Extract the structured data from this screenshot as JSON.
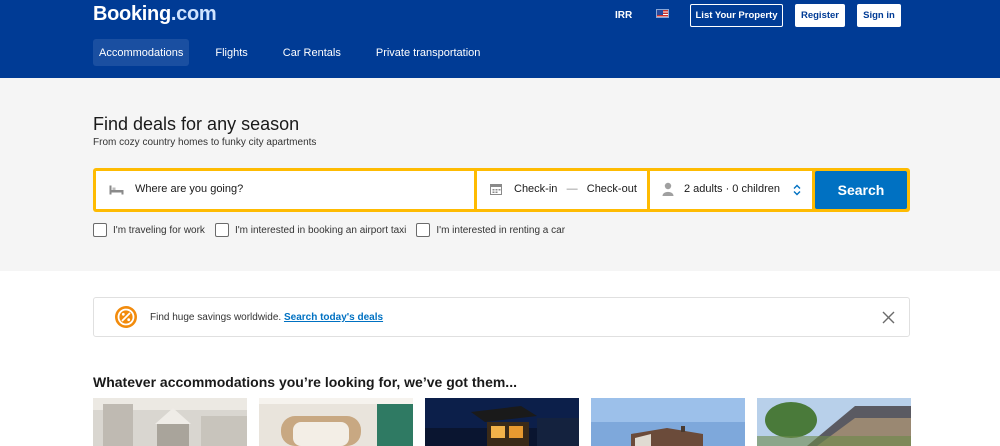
{
  "header": {
    "logo_main": "Booking",
    "logo_suffix": ".com",
    "currency": "IRR",
    "list_property_label": "List Your Property",
    "register_label": "Register",
    "signin_label": "Sign in"
  },
  "nav": {
    "items": [
      {
        "label": "Accommodations",
        "active": true
      },
      {
        "label": "Flights",
        "active": false
      },
      {
        "label": "Car Rentals",
        "active": false
      },
      {
        "label": "Private transportation",
        "active": false
      }
    ]
  },
  "hero": {
    "title": "Find deals for any season",
    "subtitle": "From cozy country homes to funky city apartments"
  },
  "search": {
    "destination_placeholder": "Where are you going?",
    "checkin": "Check-in",
    "separator": "—",
    "checkout": "Check-out",
    "guests": "2 adults · 0 children",
    "button_label": "Search"
  },
  "options": [
    {
      "label": "I'm traveling for work",
      "checked": false
    },
    {
      "label": "I'm interested in booking an airport taxi",
      "checked": false
    },
    {
      "label": "I'm interested in renting a car",
      "checked": false
    }
  ],
  "banner": {
    "text": "Find huge savings worldwide.",
    "link": "Search today's deals"
  },
  "section": {
    "title": "Whatever accommodations you’re looking for, we’ve got them..."
  },
  "colors": {
    "brand_blue": "#003b95",
    "search_yellow": "#febb02",
    "search_button": "#0071c2",
    "banner_icon_orange": "#f28b0c"
  },
  "icons": {
    "destination": "bed-icon",
    "dates": "calendar-icon",
    "guests": "person-icon",
    "guests_toggle": "chevron-up-down-icon",
    "banner": "deal-tag-icon",
    "banner_close": "close-icon",
    "flag": "us-flag-icon"
  }
}
